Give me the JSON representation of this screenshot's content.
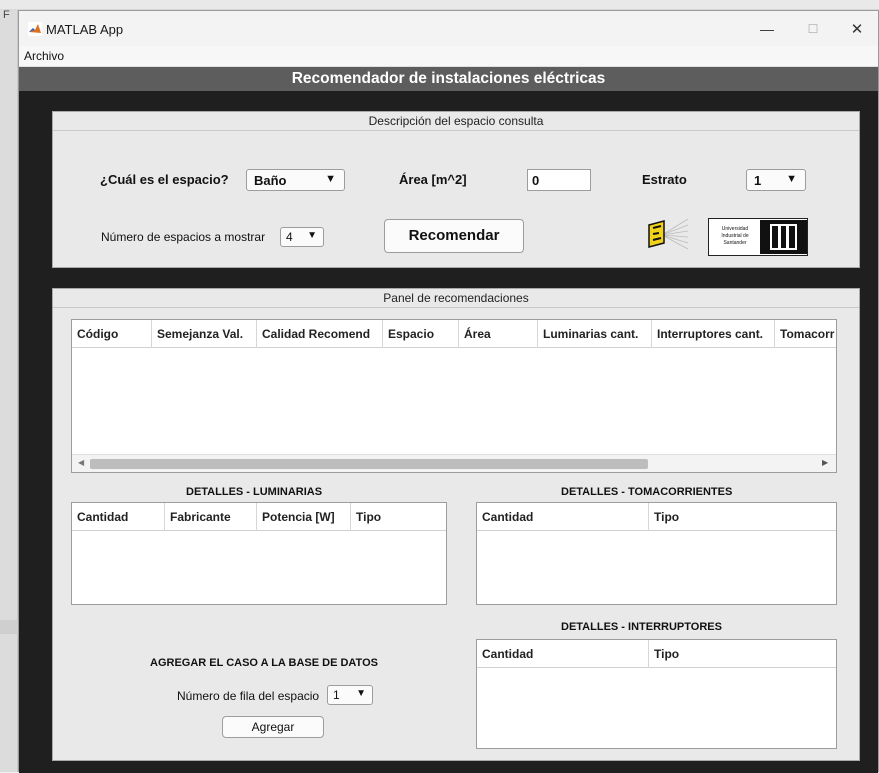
{
  "window": {
    "title": "MATLAB App",
    "minimize_glyph": "—",
    "maximize_glyph": "☐",
    "close_glyph": "✕",
    "icon": "matlab-icon"
  },
  "menu": {
    "archivo": "Archivo"
  },
  "header": {
    "title": "Recomendador de instalaciones eléctricas"
  },
  "consulta": {
    "title": "Descripción del espacio consulta",
    "espacio_label": "¿Cuál es el espacio?",
    "espacio_value": "Baño",
    "area_label": "Área [m^2]",
    "area_value": "0",
    "estrato_label": "Estrato",
    "estrato_value": "1",
    "num_label": "Número de espacios a mostrar",
    "num_value": "4",
    "recomendar_label": "Recomendar",
    "uis_text": "Universidad Industrial de Santander"
  },
  "recomendaciones": {
    "title": "Panel de recomendaciones",
    "columns": [
      "Código",
      "Semejanza Val.",
      "Calidad Recomend",
      "Espacio",
      "Área",
      "Luminarias cant.",
      "Interruptores cant.",
      "Tomacorr"
    ]
  },
  "luminarias": {
    "title": "DETALLES - LUMINARIAS",
    "columns": [
      "Cantidad",
      "Fabricante",
      "Potencia [W]",
      "Tipo"
    ]
  },
  "tomacorrientes": {
    "title": "DETALLES - TOMACORRIENTES",
    "columns": [
      "Cantidad",
      "Tipo"
    ]
  },
  "interruptores": {
    "title": "DETALLES - INTERRUPTORES",
    "columns": [
      "Cantidad",
      "Tipo"
    ]
  },
  "agregar": {
    "title": "AGREGAR EL CASO A LA BASE DE DATOS",
    "fila_label": "Número de fila del espacio",
    "fila_value": "1",
    "button_label": "Agregar"
  },
  "colors": {
    "header_band": "#5d5d5d",
    "background_dark": "#1f1f1f",
    "panel": "#e9e9e9"
  }
}
